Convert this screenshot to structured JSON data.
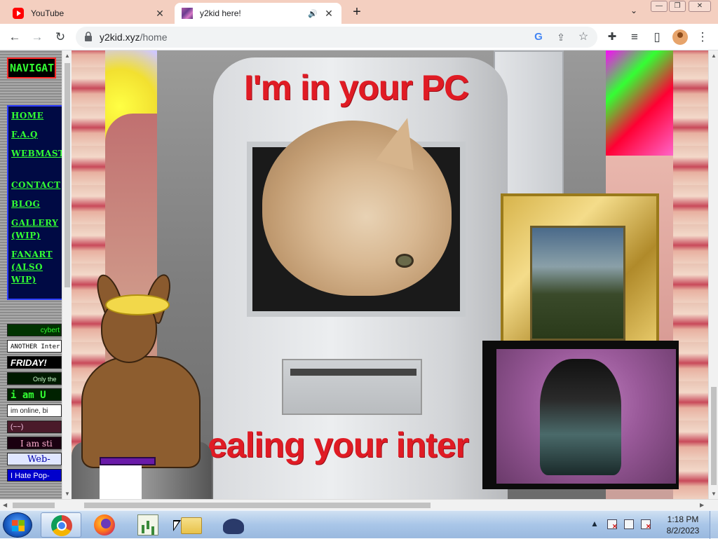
{
  "browser": {
    "tabs": [
      {
        "title": "YouTube",
        "favicon": "youtube-icon",
        "active": false
      },
      {
        "title": "y2kid here!",
        "favicon": "y2kid-favicon",
        "active": true,
        "audio": true
      }
    ],
    "new_tab_label": "+",
    "tab_search_glyph": "⌄",
    "url_host": "y2kid.xyz",
    "url_path": "/home",
    "window_controls": {
      "minimize": "—",
      "maximize": "❐",
      "close": "✕"
    },
    "toolbar_glyphs": {
      "back": "←",
      "forward": "→",
      "reload": "↻",
      "google_lens": "G",
      "share": "⇪",
      "bookmark": "☆",
      "extensions": "✚",
      "media": "≡",
      "side_panel": "▯",
      "menu": "⋮"
    },
    "tab_close": "✕",
    "speaker": "🔊"
  },
  "page": {
    "nav_heading": "NAVIGATION",
    "nav_links": [
      "HOME",
      "F.A.Q",
      "WEBMASTER",
      "CONTACT",
      "BLOG",
      "GALLERY (WIP)",
      "FANART (ALSO WIP)"
    ],
    "badges": [
      "cybert",
      "ANOTHER Inter",
      "FRIDAY!",
      "Only the",
      "i am U",
      "im online, bi",
      "(~~)",
      "I am sti",
      "Web-",
      "I Hate Pop-"
    ],
    "caption_top": "I'm in your PC",
    "caption_bottom": "ealing your inter"
  },
  "taskbar": {
    "apps": [
      "Google Chrome",
      "Firefox",
      "Chart App",
      "File Explorer",
      "Game Launcher"
    ],
    "time": "1:18 PM",
    "date": "8/2/2023",
    "tray_arrow": "▲"
  },
  "colors": {
    "tabstrip": "#f4cfc0",
    "nav_text": "#33ff33",
    "nav_bg": "#000a44",
    "caption_red": "#e01b24"
  }
}
